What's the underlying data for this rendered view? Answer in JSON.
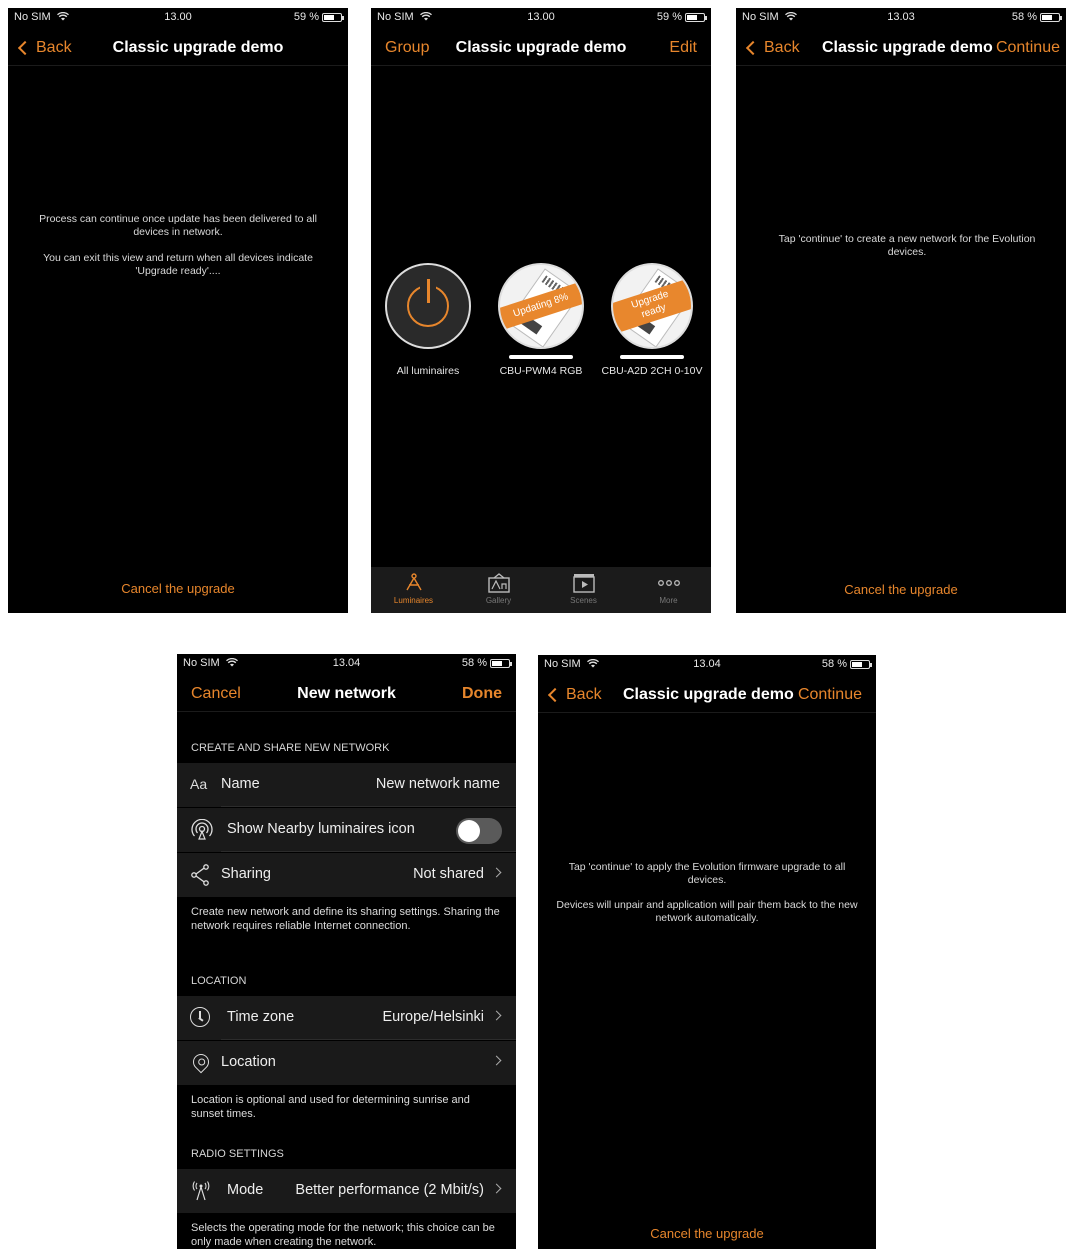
{
  "screen1": {
    "status": {
      "carrier": "No SIM",
      "time": "13.00",
      "battery": "59 %"
    },
    "nav": {
      "back": "Back",
      "title": "Classic upgrade demo"
    },
    "message1": "Process can continue once update has been delivered to all devices in network.",
    "message2": "You can exit this view and return when all devices indicate 'Upgrade ready'....",
    "cancel": "Cancel the upgrade"
  },
  "screen2": {
    "status": {
      "carrier": "No SIM",
      "time": "13.00",
      "battery": "59 %"
    },
    "nav": {
      "left": "Group",
      "title": "Classic upgrade demo",
      "right": "Edit"
    },
    "luminaires": [
      {
        "label": "All luminaires"
      },
      {
        "label": "CBU-PWM4 RGB",
        "badge": "Updating 8%"
      },
      {
        "label": "CBU-A2D 2CH 0-10V",
        "badge_line1": "Upgrade",
        "badge_line2": "ready"
      }
    ],
    "tabs": [
      {
        "label": "Luminaires"
      },
      {
        "label": "Gallery"
      },
      {
        "label": "Scenes"
      },
      {
        "label": "More"
      }
    ]
  },
  "screen3": {
    "status": {
      "carrier": "No SIM",
      "time": "13.03",
      "battery": "58 %"
    },
    "nav": {
      "back": "Back",
      "title": "Classic upgrade demo",
      "right": "Continue"
    },
    "message1": "Tap 'continue' to create a new network for the Evolution devices.",
    "cancel": "Cancel the upgrade"
  },
  "screen4": {
    "status": {
      "carrier": "No SIM",
      "time": "13.04",
      "battery": "58 %"
    },
    "nav": {
      "left": "Cancel",
      "title": "New network",
      "right": "Done"
    },
    "section1": "CREATE AND SHARE NEW NETWORK",
    "name_icon": "Aa",
    "name_label": "Name",
    "name_value": "New network name",
    "nearby_label": "Show Nearby luminaires icon",
    "sharing_label": "Sharing",
    "sharing_value": "Not shared",
    "footer1": "Create new network and define its sharing settings. Sharing the network requires reliable Internet connection.",
    "section2": "LOCATION",
    "timezone_label": "Time zone",
    "timezone_value": "Europe/Helsinki",
    "location_label": "Location",
    "footer2": "Location is optional and used for determining sunrise and sunset times.",
    "section3": "RADIO SETTINGS",
    "mode_label": "Mode",
    "mode_value": "Better performance (2 Mbit/s)",
    "footer3": "Selects the operating mode for the network; this choice can be only made when creating the network."
  },
  "screen5": {
    "status": {
      "carrier": "No SIM",
      "time": "13.04",
      "battery": "58 %"
    },
    "nav": {
      "back": "Back",
      "title": "Classic upgrade demo",
      "right": "Continue"
    },
    "message1": "Tap 'continue' to apply the Evolution firmware upgrade to all devices.",
    "message2": "Devices will unpair and application will pair them back to the new network automatically.",
    "cancel": "Cancel the upgrade"
  },
  "colors": {
    "accent": "#e7862c",
    "background": "#000000",
    "row": "#1a1a1a"
  }
}
